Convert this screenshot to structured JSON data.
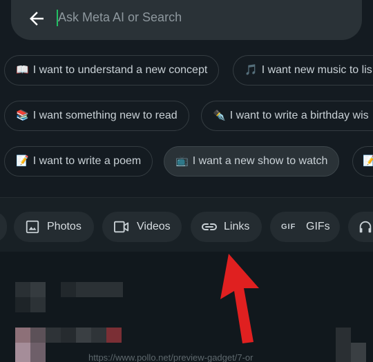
{
  "search": {
    "placeholder": "Ask Meta AI or Search"
  },
  "suggestions": {
    "row1": [
      {
        "emoji": "📖",
        "label": "I want to understand a new concept"
      },
      {
        "emoji": "🎵",
        "label": "I want new music to lis"
      }
    ],
    "row2": [
      {
        "emoji": "📚",
        "label": "I want something new to read"
      },
      {
        "emoji": "✒️",
        "label": "I want to write a birthday wis"
      }
    ],
    "row3": [
      {
        "emoji": "📝",
        "label": "I want to write a poem"
      },
      {
        "emoji": "📺",
        "label": "I want a new show to watch"
      },
      {
        "emoji": "📝",
        "label": ""
      }
    ]
  },
  "filters": {
    "photos": "Photos",
    "videos": "Videos",
    "links": "Links",
    "gifs": "GIFs",
    "gif_badge": "GIF"
  },
  "results": {
    "url": "https://www.pollo.net/preview-gadget/7-or"
  },
  "colors": {
    "background": "#141b21",
    "search_bar": "#2a3237",
    "cursor": "#21c063",
    "arrow": "#e02020"
  }
}
